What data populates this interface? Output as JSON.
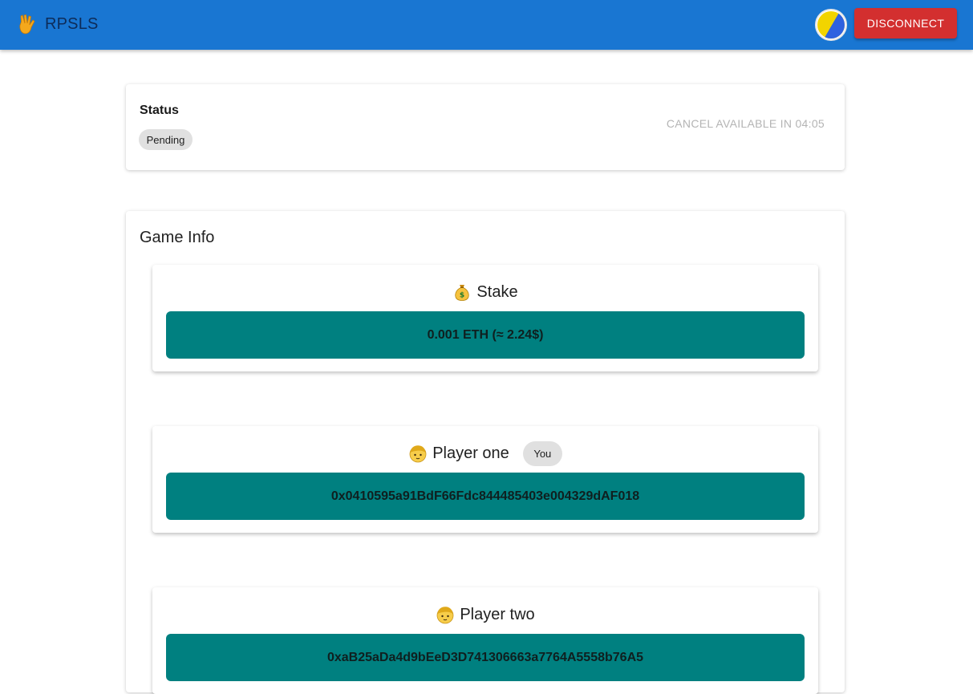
{
  "appbar": {
    "brand_icon": "vulcan-salute-hand-icon",
    "title": "RPSLS",
    "avatar_icon": "wallet-avatar-icon",
    "disconnect_label": "DISCONNECT",
    "colors": {
      "bar": "#1976d2",
      "disconnect": "#d32f2f"
    }
  },
  "status_card": {
    "label": "Status",
    "chip": "Pending",
    "cancel_note": "CANCEL AVAILABLE IN 04:05"
  },
  "game_info": {
    "title": "Game Info",
    "stake": {
      "icon": "money-bag-icon",
      "label": "Stake",
      "value": "0.001 ETH (≈ 2.24$)"
    },
    "player_one": {
      "icon": "person-face-icon",
      "label": "Player one",
      "badge": "You",
      "address": "0x0410595a91BdF66Fdc844485403e004329dAF018"
    },
    "player_two": {
      "icon": "person-face-icon",
      "label": "Player two",
      "address": "0xaB25aDa4d9bEeD3D741306663a7764A5558b76A5"
    },
    "colors": {
      "value_bar": "#008080"
    }
  }
}
